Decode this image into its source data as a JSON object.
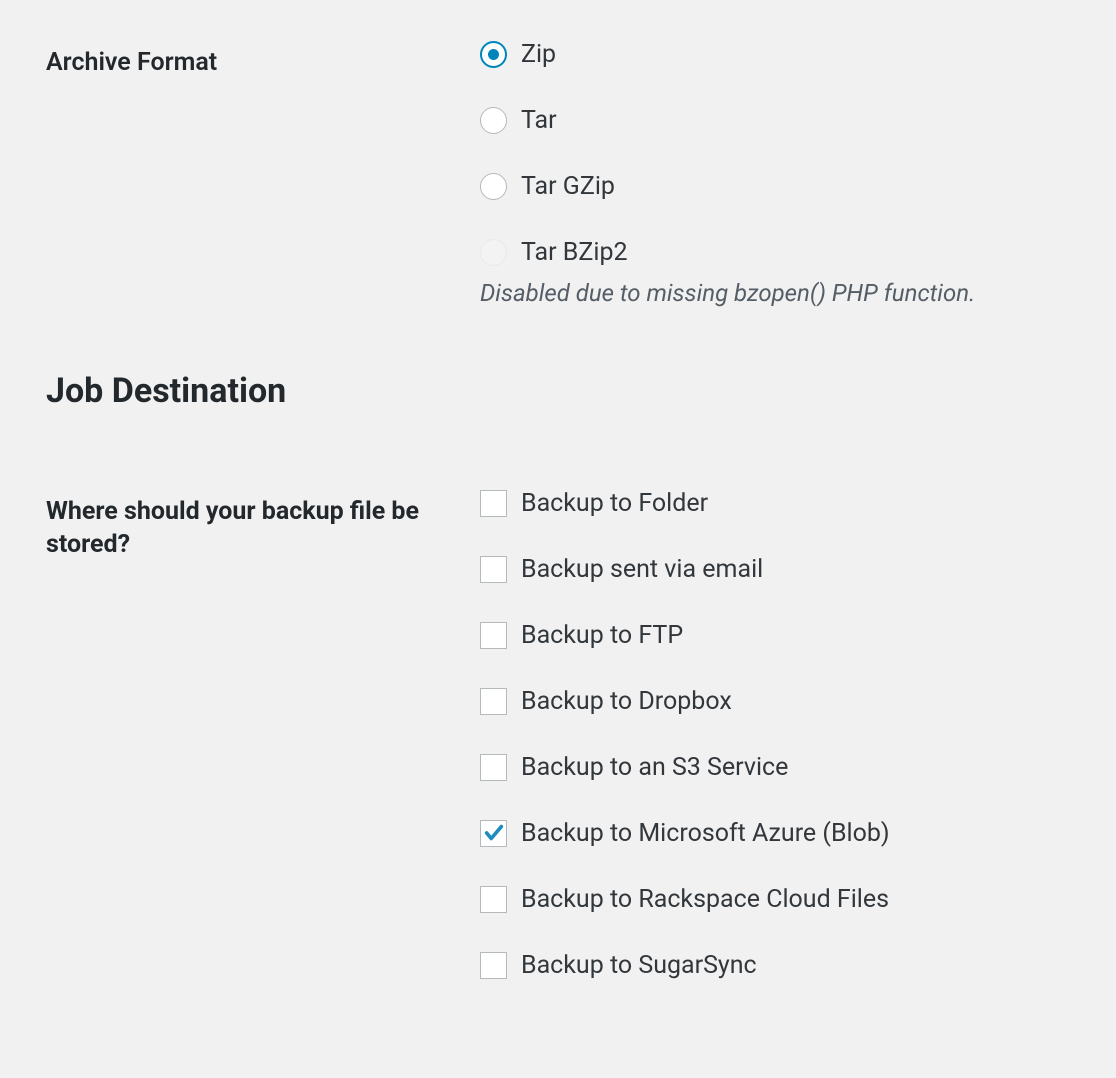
{
  "archive_format": {
    "label": "Archive Format",
    "options": [
      {
        "label": "Zip",
        "selected": true,
        "disabled": false
      },
      {
        "label": "Tar",
        "selected": false,
        "disabled": false
      },
      {
        "label": "Tar GZip",
        "selected": false,
        "disabled": false
      },
      {
        "label": "Tar BZip2",
        "selected": false,
        "disabled": true
      }
    ],
    "disabled_note": "Disabled due to missing bzopen() PHP function."
  },
  "job_destination": {
    "heading": "Job Destination",
    "question": "Where should your backup file be stored?",
    "options": [
      {
        "label": "Backup to Folder",
        "checked": false
      },
      {
        "label": "Backup sent via email",
        "checked": false
      },
      {
        "label": "Backup to FTP",
        "checked": false
      },
      {
        "label": "Backup to Dropbox",
        "checked": false
      },
      {
        "label": "Backup to an S3 Service",
        "checked": false
      },
      {
        "label": "Backup to Microsoft Azure (Blob)",
        "checked": true
      },
      {
        "label": "Backup to Rackspace Cloud Files",
        "checked": false
      },
      {
        "label": "Backup to SugarSync",
        "checked": false
      }
    ]
  }
}
